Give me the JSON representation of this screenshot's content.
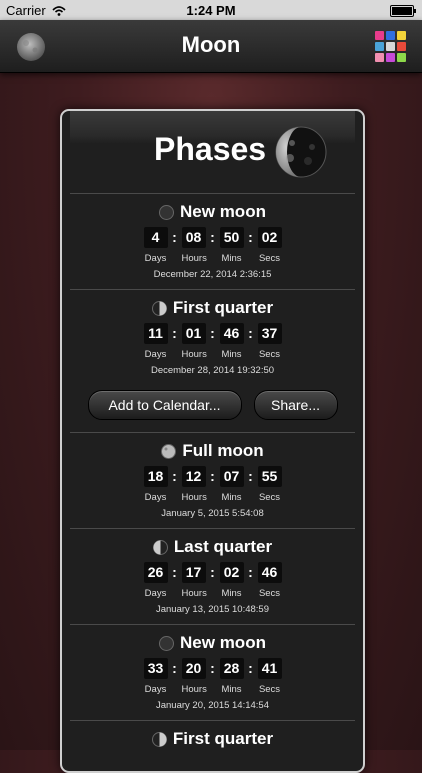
{
  "status_bar": {
    "carrier": "Carrier",
    "time": "1:24 PM"
  },
  "nav": {
    "title": "Moon"
  },
  "card": {
    "title": "Phases"
  },
  "phases": [
    {
      "name": "New moon",
      "days": "4",
      "hours": "08",
      "mins": "50",
      "secs": "02",
      "date": "December 22, 2014  2:36:15"
    },
    {
      "name": "First quarter",
      "days": "11",
      "hours": "01",
      "mins": "46",
      "secs": "37",
      "date": "December 28, 2014  19:32:50"
    },
    {
      "name": "Full moon",
      "days": "18",
      "hours": "12",
      "mins": "07",
      "secs": "55",
      "date": "January 5, 2015  5:54:08"
    },
    {
      "name": "Last quarter",
      "days": "26",
      "hours": "17",
      "mins": "02",
      "secs": "46",
      "date": "January 13, 2015  10:48:59"
    },
    {
      "name": "New moon",
      "days": "33",
      "hours": "20",
      "mins": "28",
      "secs": "41",
      "date": "January 20, 2015  14:14:54"
    },
    {
      "name": "First quarter"
    }
  ],
  "units": {
    "days": "Days",
    "hours": "Hours",
    "mins": "Mins",
    "secs": "Secs"
  },
  "buttons": {
    "add_calendar": "Add to Calendar...",
    "share": "Share..."
  },
  "icons": {
    "nav_left": "moon-icon",
    "nav_right": "color-grid-icon",
    "card": "moon-crescent-icon"
  },
  "colors": {
    "grid": [
      "#e83c8c",
      "#2f6fe0",
      "#f3d43a",
      "#4aa3d8",
      "#d8d8d8",
      "#e84a3a",
      "#f08fb0",
      "#c64ad8",
      "#8dd84a"
    ]
  }
}
